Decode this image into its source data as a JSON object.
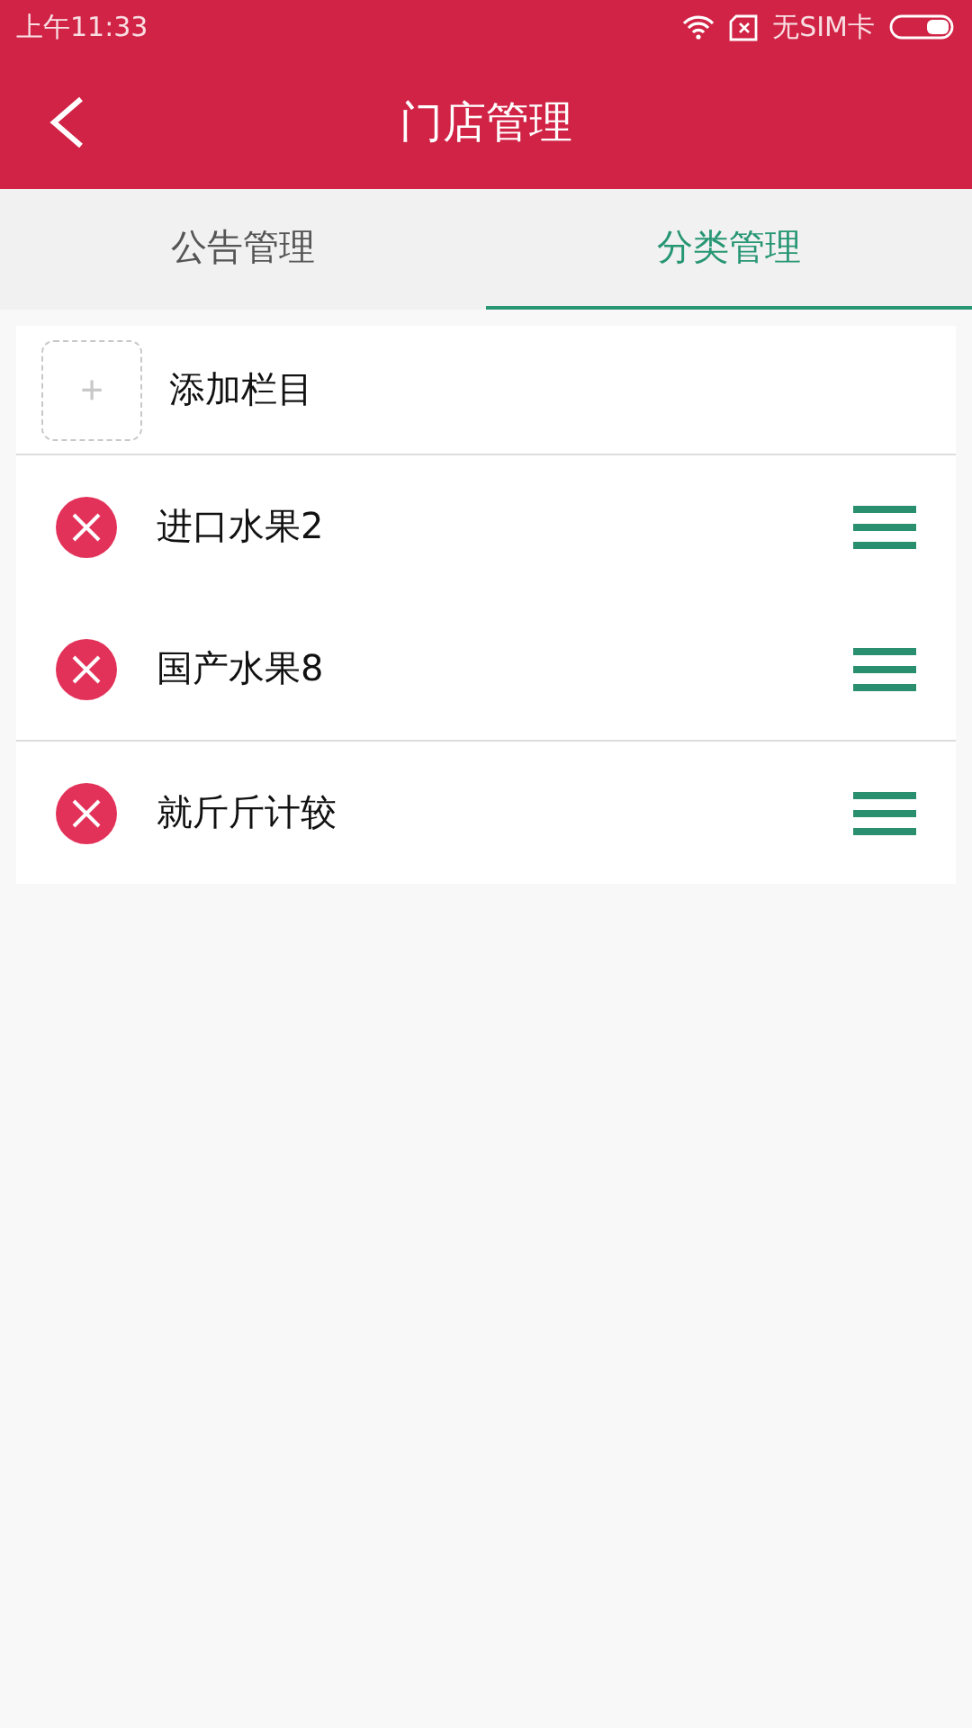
{
  "status_bar": {
    "time": "上午11:33",
    "carrier": "无SIM卡"
  },
  "app_bar": {
    "title": "门店管理"
  },
  "tabs": [
    {
      "label": "公告管理",
      "selected": false
    },
    {
      "label": "分类管理",
      "selected": true
    }
  ],
  "add_item": {
    "label": "添加栏目",
    "icon": "+"
  },
  "categories": [
    {
      "name": "进口水果2",
      "divider_above": true
    },
    {
      "name": "国产水果8",
      "divider_above": false
    },
    {
      "name": "就斤斤计较",
      "divider_above": true
    }
  ]
}
